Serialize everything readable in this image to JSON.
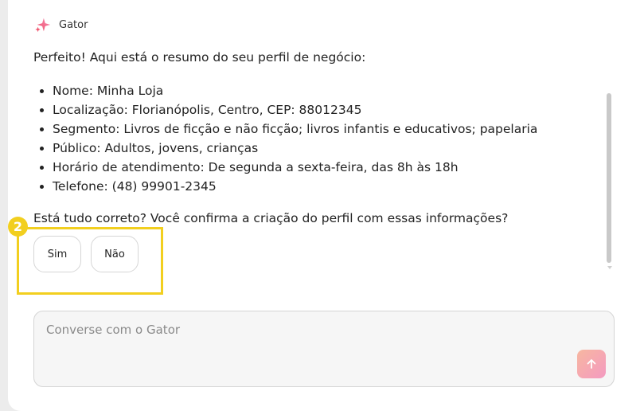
{
  "assistant": {
    "name": "Gator",
    "icon": "sparkle-icon"
  },
  "message": {
    "intro": "Perfeito! Aqui está o resumo do seu perfil de negócio:",
    "items": [
      "Nome: Minha Loja",
      "Localização: Florianópolis, Centro, CEP: 88012345",
      "Segmento: Livros de ficção e não ficção; livros infantis e educativos; papelaria",
      "Público: Adultos, jovens, crianças",
      "Horário de atendimento: De segunda a sexta-feira, das 8h às 18h",
      "Telefone: (48) 99901-2345"
    ],
    "question": "Está tudo correto? Você confirma a criação do perfil com essas informações?"
  },
  "highlight": {
    "badge": "2",
    "color": "#f2cf1f"
  },
  "buttons": {
    "yes_label": "Sim",
    "no_label": "Não"
  },
  "composer": {
    "placeholder": "Converse com o Gator",
    "value": "",
    "send_icon": "arrow-up-icon"
  },
  "colors": {
    "send_gradient_start": "#f7b7a0",
    "send_gradient_end": "#f49ac1"
  }
}
